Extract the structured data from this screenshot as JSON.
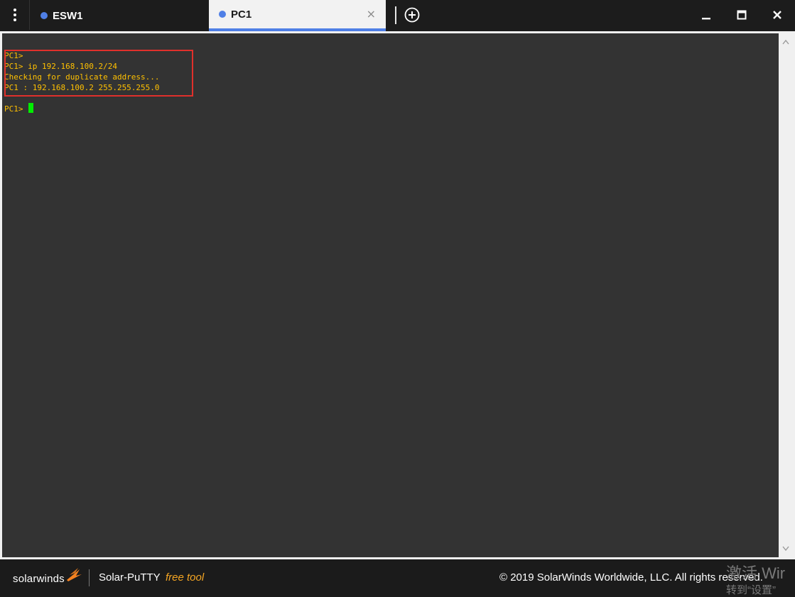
{
  "tabs": [
    {
      "label": "ESW1",
      "dot_color": "#4f7fe6",
      "active": false
    },
    {
      "label": "PC1",
      "dot_color": "#4f7fe6",
      "active": true,
      "close_icon": "×"
    }
  ],
  "window_controls": [
    "minimize-icon",
    "maximize-icon",
    "close-icon"
  ],
  "terminal": {
    "lines": [
      "PC1>",
      "PC1> ip 192.168.100.2/24",
      "Checking for duplicate address...",
      "PC1 : 192.168.100.2 255.255.255.0",
      "",
      "PC1> "
    ],
    "text_color": "#ffc000",
    "cursor_color": "#00ee00",
    "background": "#333333",
    "highlight_color": "#e0302b"
  },
  "footer": {
    "brand": "solarwinds",
    "product": "Solar-PuTTY",
    "free_label": "free tool",
    "copyright": "© 2019 SolarWinds Worldwide, LLC. All rights reserved.",
    "watermark_line1": "激活 Wir",
    "watermark_line2": "转到“设置”"
  }
}
